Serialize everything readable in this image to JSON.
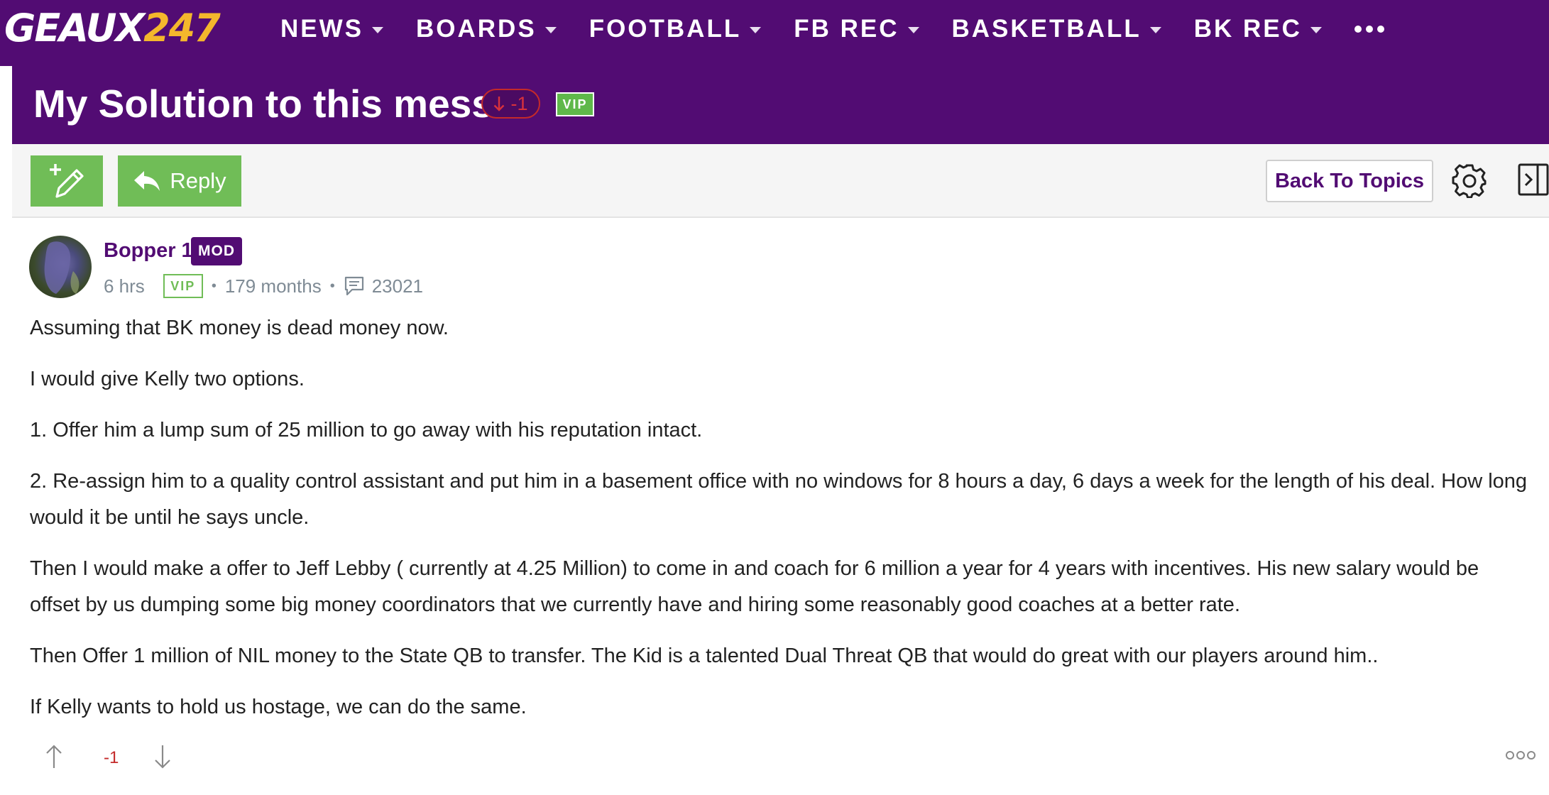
{
  "nav": {
    "logo_text": "GEAUX",
    "logo_num": "247",
    "items": [
      {
        "label": "NEWS"
      },
      {
        "label": "BOARDS"
      },
      {
        "label": "FOOTBALL"
      },
      {
        "label": "FB REC"
      },
      {
        "label": "BASKETBALL"
      },
      {
        "label": "BK REC"
      }
    ],
    "more_icon": "ellipsis-icon"
  },
  "thread": {
    "title": "My Solution to this mess",
    "vote_badge": "-1",
    "vip_badge": "VIP"
  },
  "toolbar": {
    "new_topic_icon": "new-topic-pencil-icon",
    "reply_label": "Reply",
    "back_label": "Back To Topics",
    "settings_icon": "gear-icon",
    "collapse_icon": "collapse-panel-icon"
  },
  "post": {
    "author": "Bopper 1",
    "role_badge": "MOD",
    "time": "6 hrs",
    "vip_badge": "VIP",
    "tenure": "179 months",
    "post_count": "23021",
    "paragraphs": [
      "Assuming that BK money is dead money now.",
      "I would give Kelly two options.",
      "1. Offer him a lump sum of 25 million to go away with his reputation intact.",
      "2. Re-assign him to a quality control assistant and put him in a basement office with no windows for 8 hours a day, 6 days a week for the length of his deal. How long would it be until he says uncle.",
      "Then I would make a offer to Jeff Lebby ( currently at 4.25 Million) to come in and coach for 6 million a year for 4 years with incentives. His new salary would be offset by us dumping some big money coordinators that we currently have and hiring some reasonably good coaches at a better rate.",
      "Then Offer 1 million of NIL money to the State QB to transfer. The Kid is a talented Dual Threat QB that would do great with our players around him..",
      "If Kelly wants to hold us hostage, we can do the same."
    ],
    "score": "-1"
  },
  "colors": {
    "brand_purple": "#520c73",
    "action_green": "#70bd57",
    "logo_gold": "#f4b72c",
    "downvote_red": "#c42a2a"
  }
}
